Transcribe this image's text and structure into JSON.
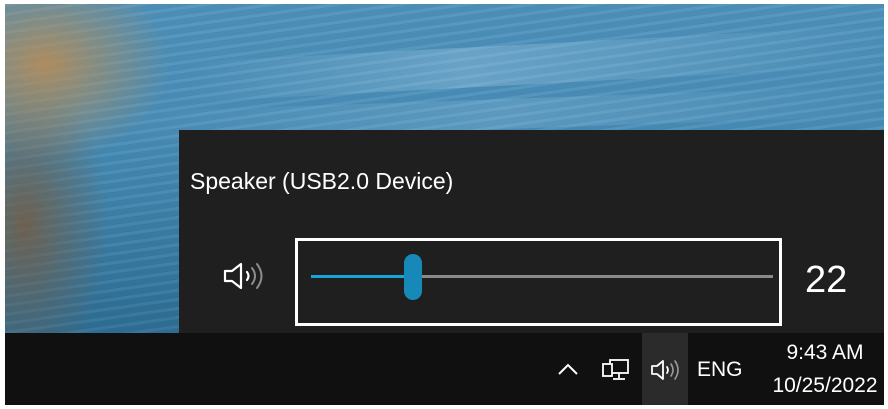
{
  "flyout": {
    "device_name": "Speaker (USB2.0 Device)",
    "speaker_icon": "speaker-volume-icon",
    "volume": {
      "value_label": "22",
      "level": 0.22
    },
    "accent_color": "#1aa3d8"
  },
  "taskbar": {
    "tray_icons": [
      "chevron-up-icon",
      "network-icon",
      "speaker-volume-icon"
    ],
    "language": "ENG",
    "clock": {
      "time": "9:43 AM",
      "date": "10/25/2022"
    }
  }
}
